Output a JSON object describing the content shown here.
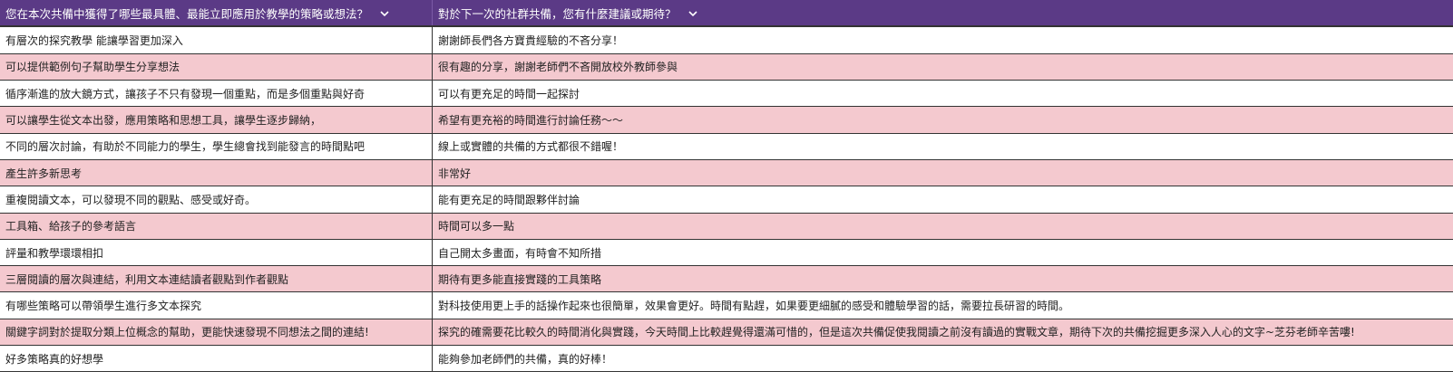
{
  "columns": [
    "您在本次共備中獲得了哪些最具體、最能立即應用於教學的策略或想法？",
    "對於下一次的社群共備，您有什麼建議或期待？"
  ],
  "rows": [
    [
      "有層次的探究教學 能讓學習更加深入",
      "謝謝師長們各方寶貴經驗的不吝分享！"
    ],
    [
      "可以提供範例句子幫助學生分享想法",
      "很有趣的分享，謝謝老師們不吝開放校外教師參與"
    ],
    [
      "循序漸進的放大鏡方式，讓孩子不只有發現一個重點，而是多個重點與好奇",
      "可以有更充足的時間一起探討"
    ],
    [
      "可以讓學生從文本出發，應用策略和思想工具，讓學生逐步歸納，",
      "希望有更充裕的時間進行討論任務～～"
    ],
    [
      "不同的層次討論，有助於不同能力的學生，學生總會找到能發言的時間點吧",
      "線上或實體的共備的方式都很不錯喔！"
    ],
    [
      "產生許多新思考",
      "非常好"
    ],
    [
      "重複閱讀文本，可以發現不同的觀點、感受或好奇。",
      "能有更充足的時間跟夥伴討論"
    ],
    [
      "工具箱、給孩子的參考語言",
      "時間可以多一點"
    ],
    [
      "評量和教學環環相扣",
      "自己開太多畫面，有時會不知所措"
    ],
    [
      "三層閱讀的層次與連結，利用文本連結讀者觀點到作者觀點",
      "期待有更多能直接實踐的工具策略"
    ],
    [
      "有哪些策略可以帶領學生進行多文本探究",
      "對科技使用更上手的話操作起來也很簡單，效果會更好。時間有點趕，如果要更細膩的感受和體驗學習的話，需要拉長研習的時間。"
    ],
    [
      "關鍵字詞對於提取分類上位概念的幫助，更能快速發現不同想法之間的連結!",
      "探究的確需要花比較久的時間消化與實踐，今天時間上比較趕覺得還滿可惜的，但是這次共備促使我閱讀之前沒有讀過的實戰文章，期待下次的共備挖掘更多深入人心的文字~芝芬老師辛苦嘍!"
    ],
    [
      "好多策略真的好想學",
      "能夠參加老師們的共備，真的好棒！"
    ]
  ]
}
